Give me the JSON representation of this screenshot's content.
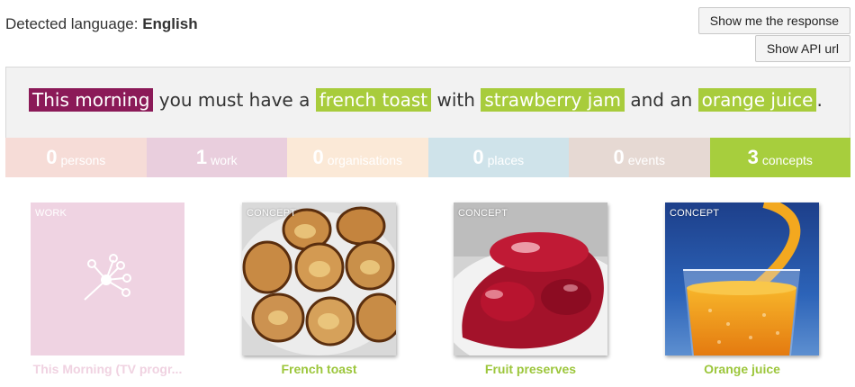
{
  "header": {
    "detected_label": "Detected language:",
    "detected_value": "English",
    "show_response_label": "Show me the response",
    "show_api_label": "Show API url"
  },
  "sentence": {
    "part1": "This morning",
    "part2": " you must have a ",
    "part3": "french toast",
    "part4": " with ",
    "part5": "strawberry jam",
    "part6": " and an ",
    "part7": "orange juice",
    "part8": "."
  },
  "tabs": [
    {
      "count": "0",
      "label": "persons"
    },
    {
      "count": "1",
      "label": "work"
    },
    {
      "count": "0",
      "label": "organisations"
    },
    {
      "count": "0",
      "label": "places"
    },
    {
      "count": "0",
      "label": "events"
    },
    {
      "count": "3",
      "label": "concepts"
    }
  ],
  "cards": [
    {
      "tag": "WORK",
      "title": "This Morning (TV progr..."
    },
    {
      "tag": "CONCEPT",
      "title": "French toast"
    },
    {
      "tag": "CONCEPT",
      "title": "Fruit preserves"
    },
    {
      "tag": "CONCEPT",
      "title": "Orange juice"
    }
  ],
  "colors": {
    "work": "#8b1a58",
    "concept": "#a8cc3c"
  }
}
